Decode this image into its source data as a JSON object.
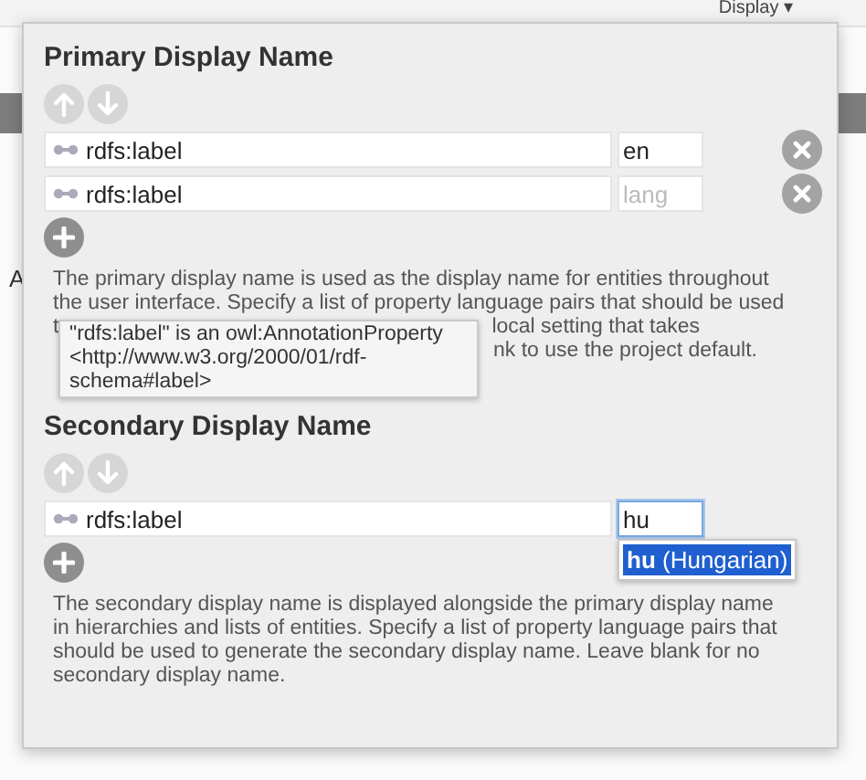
{
  "background": {
    "menu": "Display ▾",
    "side_letter": "A"
  },
  "sections": [
    {
      "title": "Primary Display Name",
      "move_up": {
        "disabled": true
      },
      "move_down": {
        "disabled": true
      },
      "rows": [
        {
          "property": "rdfs:label",
          "lang": "en",
          "removable": true,
          "focused": false
        },
        {
          "property": "rdfs:label",
          "lang_placeholder": "lang",
          "removable": true,
          "focused": false
        }
      ],
      "description": [
        {
          "text": "The primary display name is used as the display name for entities throughout"
        },
        {
          "text": "the user interface. Specify a list of property language pairs that should be used"
        },
        {
          "left": "t",
          "right": "local setting that takes"
        },
        {
          "right": "nk to use the project default."
        }
      ],
      "tooltip": "\"rdfs:label\" is an owl:AnnotationProperty <http://www.w3.org/2000/01/rdf-schema#label>"
    },
    {
      "title": "Secondary Display Name",
      "move_up": {
        "disabled": true
      },
      "move_down": {
        "disabled": true
      },
      "rows": [
        {
          "property": "rdfs:label",
          "lang": "hu",
          "removable": false,
          "focused": true,
          "suggestions": [
            {
              "label": "**hu** (Hungarian)",
              "selected": true
            }
          ]
        }
      ],
      "description": [
        {
          "text": "The secondary display name is displayed alongside the primary display name"
        },
        {
          "text": "in hierarchies and lists of entities. Specify a list of property language pairs that"
        },
        {
          "text": "should be used to generate the secondary display name. Leave blank for no"
        },
        {
          "text": "secondary display name."
        }
      ]
    }
  ]
}
